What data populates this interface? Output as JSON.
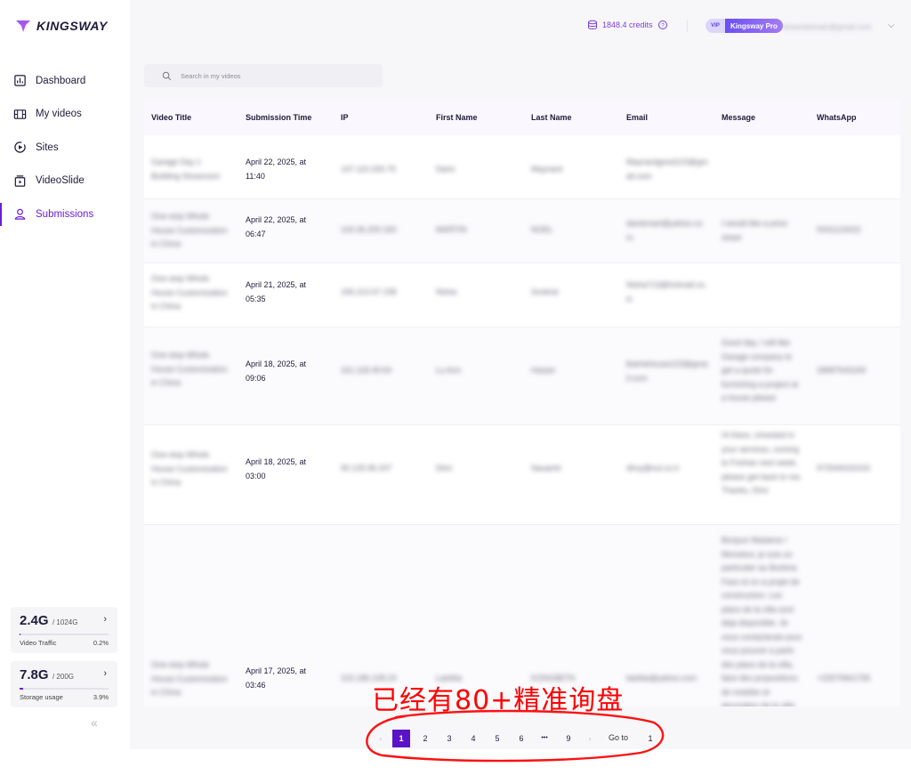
{
  "brand": {
    "name": "KINGSWAY",
    "accent": "#6a1fd6"
  },
  "sidebar": {
    "items": [
      {
        "label": "Dashboard",
        "icon": "dashboard-icon",
        "active": false
      },
      {
        "label": "My videos",
        "icon": "video-icon",
        "active": false
      },
      {
        "label": "Sites",
        "icon": "sites-icon",
        "active": false
      },
      {
        "label": "VideoSlide",
        "icon": "videoslide-icon",
        "active": false
      },
      {
        "label": "Submissions",
        "icon": "submissions-icon",
        "active": true
      }
    ],
    "traffic": {
      "value": "2.4G",
      "total": "/ 1024G",
      "label": "Video Traffic",
      "percent": "0.2%",
      "fraction": 0.002
    },
    "storage": {
      "value": "7.8G",
      "total": "/ 200G",
      "label": "Storage usage",
      "percent": "3.9%",
      "fraction": 0.039
    },
    "collapse_glyph": "«"
  },
  "topbar": {
    "credits": "1848.4 credits",
    "help_glyph": "?",
    "vip_badge": "VIP",
    "plan": "Kingsway Pro",
    "email": "dreamdomain@gmail.com",
    "chevron": "⌵"
  },
  "search": {
    "placeholder": "Search in my videos"
  },
  "table": {
    "columns": [
      "Video Title",
      "Submission Time",
      "IP",
      "First Name",
      "Last Name",
      "Email",
      "Message",
      "WhatsApp"
    ],
    "rows": [
      {
        "title": "Garage Day 1 Building Showroom",
        "time": "April 22, 2025, at 11:40",
        "ip": "147.110.200.75",
        "first": "Darin",
        "last": "Maynard",
        "email": "Maynardgood123@gmail.com",
        "message": "",
        "whatsapp": ""
      },
      {
        "title": "One-stop Whole House Customization in China",
        "time": "April 22, 2025, at 06:47",
        "ip": "143.36.200.160",
        "first": "MARTIN",
        "last": "NOEL",
        "email": "daniemart@yahoo.com",
        "message": "I would like a price sheet",
        "whatsapp": "0041123422"
      },
      {
        "title": "One-stop Whole House Customization in China",
        "time": "April 21, 2025, at 05:35",
        "ip": "156.213.67.158",
        "first": "Nisha",
        "last": "Sookrai",
        "email": "Nisha713@hotmail.co.in",
        "message": "",
        "whatsapp": ""
      },
      {
        "title": "One-stop Whole House Customization in China",
        "time": "April 18, 2025, at 09:06",
        "ip": "161.118.49.64",
        "first": "Lu Ann",
        "last": "Harper",
        "email": "lbarhehouse123@gmail.com",
        "message": "Good day, I will like Garage company to get a quote for furnishing a project at a house please",
        "whatsapp": "18687643169"
      },
      {
        "title": "One-stop Whole House Customization in China",
        "time": "April 18, 2025, at 03:00",
        "ip": "90.125.96.207",
        "first": "Dimi",
        "last": "Nauanhi",
        "email": "dimy@nul.co.il",
        "message": "Hi there, Umested in your services, coming to Foshan next week, please get back to me. Thanks, Dimi",
        "whatsapp": "972549152415"
      },
      {
        "title": "One-stop Whole House Customization in China",
        "time": "April 17, 2025, at 03:46",
        "ip": "102.186.108.24",
        "first": "Laetitia",
        "last": "KONGBETA",
        "email": "laetitia@yahoo.com",
        "message": "Bonjour Madame / Monsieur, je suis un particulier au Burkina Faso et on a projet de construction. Les plans de la villa sont deja disponible. Je vous contacterais pour vous pouvoir a partir des plans de la villa, faire des propositions de mobilier et decoration de la villa",
        "whatsapp": "+22670661765"
      }
    ]
  },
  "pagination": {
    "prev": "‹",
    "pages": [
      "1",
      "2",
      "3",
      "4",
      "5",
      "6"
    ],
    "ellipsis": "•••",
    "last": "9",
    "next": "›",
    "current": "1",
    "goto_label": "Go to",
    "goto_value": "1"
  },
  "annotation": {
    "text": "已经有80+精准询盘",
    "color": "#ff0000"
  }
}
